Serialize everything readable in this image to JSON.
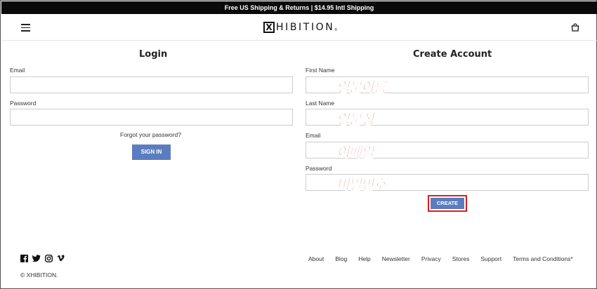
{
  "announcement": "Free US Shipping & Returns | $14.95 Intl Shipping",
  "header": {
    "logo_mark": "X",
    "logo_text": "HIBITION",
    "logo_reg": "®",
    "menu_icon": "hamburger-menu-icon",
    "cart_icon": "shopping-bag-icon"
  },
  "login": {
    "title": "Login",
    "email_label": "Email",
    "password_label": "Password",
    "forgot": "Forgot your password?",
    "signin": "SIGN IN"
  },
  "create_account": {
    "title": "Create Account",
    "first_name_label": "First Name",
    "last_name_label": "Last Name",
    "email_label": "Email",
    "password_label": "Password",
    "create": "CREATE"
  },
  "annotations": {
    "first_name": "영문이름",
    "last_name": "영문성",
    "email": "이메일",
    "password": "비밀번호"
  },
  "footer": {
    "social_icons": [
      "facebook-icon",
      "twitter-icon",
      "instagram-icon",
      "vimeo-icon"
    ],
    "copyright": "© XHIBITION.",
    "links": [
      "About",
      "Blog",
      "Help",
      "Newsletter",
      "Privacy",
      "Stores",
      "Support",
      "Terms and Conditions*"
    ]
  },
  "colors": {
    "button": "#5b7dbf",
    "highlight": "#e21b1b",
    "announcement_bg": "#0a0a0a"
  }
}
